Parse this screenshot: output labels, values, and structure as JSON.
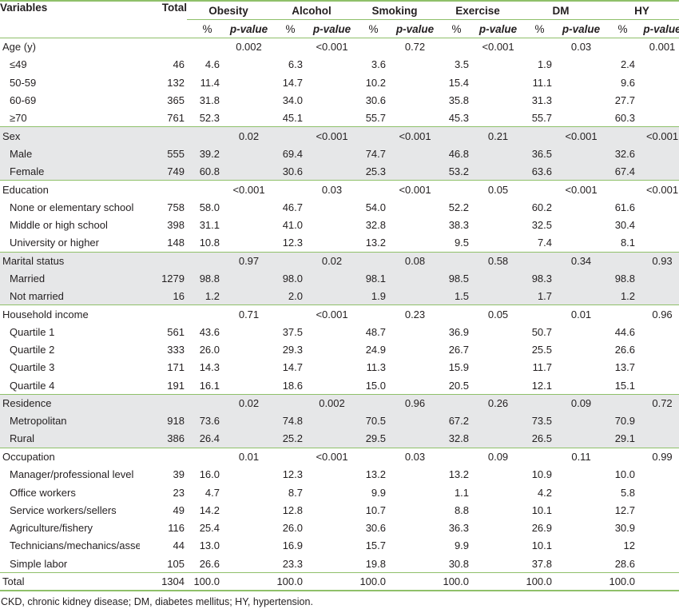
{
  "header": {
    "variables": "Variables",
    "total": "Total",
    "groups": [
      "Obesity",
      "Alcohol",
      "Smoking",
      "Exercise",
      "DM",
      "HY"
    ],
    "pct": "%",
    "pvalue": "p-value"
  },
  "sections": [
    {
      "label": "Age (y)",
      "shade": false,
      "pvalues": [
        "0.002",
        "<0.001",
        "0.72",
        "<0.001",
        "0.03",
        "0.001"
      ],
      "rows": [
        {
          "label": "≤49",
          "total": "46",
          "values": [
            "4.6",
            "6.3",
            "3.6",
            "3.5",
            "1.9",
            "2.4"
          ]
        },
        {
          "label": "50-59",
          "total": "132",
          "values": [
            "11.4",
            "14.7",
            "10.2",
            "15.4",
            "11.1",
            "9.6"
          ]
        },
        {
          "label": "60-69",
          "total": "365",
          "values": [
            "31.8",
            "34.0",
            "30.6",
            "35.8",
            "31.3",
            "27.7"
          ]
        },
        {
          "label": "≥70",
          "total": "761",
          "values": [
            "52.3",
            "45.1",
            "55.7",
            "45.3",
            "55.7",
            "60.3"
          ]
        }
      ]
    },
    {
      "label": "Sex",
      "shade": true,
      "pvalues": [
        "0.02",
        "<0.001",
        "<0.001",
        "0.21",
        "<0.001",
        "<0.001"
      ],
      "rows": [
        {
          "label": "Male",
          "total": "555",
          "values": [
            "39.2",
            "69.4",
            "74.7",
            "46.8",
            "36.5",
            "32.6"
          ]
        },
        {
          "label": "Female",
          "total": "749",
          "values": [
            "60.8",
            "30.6",
            "25.3",
            "53.2",
            "63.6",
            "67.4"
          ]
        }
      ]
    },
    {
      "label": "Education",
      "shade": false,
      "pvalues": [
        "<0.001",
        "0.03",
        "<0.001",
        "0.05",
        "<0.001",
        "<0.001"
      ],
      "rows": [
        {
          "label": "None or elementary school",
          "total": "758",
          "values": [
            "58.0",
            "46.7",
            "54.0",
            "52.2",
            "60.2",
            "61.6"
          ]
        },
        {
          "label": "Middle or high school",
          "total": "398",
          "values": [
            "31.1",
            "41.0",
            "32.8",
            "38.3",
            "32.5",
            "30.4"
          ]
        },
        {
          "label": "University or higher",
          "total": "148",
          "values": [
            "10.8",
            "12.3",
            "13.2",
            "9.5",
            "7.4",
            "8.1"
          ]
        }
      ]
    },
    {
      "label": "Marital status",
      "shade": true,
      "pvalues": [
        "0.97",
        "0.02",
        "0.08",
        "0.58",
        "0.34",
        "0.93"
      ],
      "rows": [
        {
          "label": "Married",
          "total": "1279",
          "values": [
            "98.8",
            "98.0",
            "98.1",
            "98.5",
            "98.3",
            "98.8"
          ]
        },
        {
          "label": "Not married",
          "total": "16",
          "values": [
            "1.2",
            "2.0",
            "1.9",
            "1.5",
            "1.7",
            "1.2"
          ]
        }
      ]
    },
    {
      "label": "Household income",
      "shade": false,
      "pvalues": [
        "0.71",
        "<0.001",
        "0.23",
        "0.05",
        "0.01",
        "0.96"
      ],
      "rows": [
        {
          "label": "Quartile 1",
          "total": "561",
          "values": [
            "43.6",
            "37.5",
            "48.7",
            "36.9",
            "50.7",
            "44.6"
          ]
        },
        {
          "label": "Quartile 2",
          "total": "333",
          "values": [
            "26.0",
            "29.3",
            "24.9",
            "26.7",
            "25.5",
            "26.6"
          ]
        },
        {
          "label": "Quartile 3",
          "total": "171",
          "values": [
            "14.3",
            "14.7",
            "11.3",
            "15.9",
            "11.7",
            "13.7"
          ]
        },
        {
          "label": "Quartile 4",
          "total": "191",
          "values": [
            "16.1",
            "18.6",
            "15.0",
            "20.5",
            "12.1",
            "15.1"
          ]
        }
      ]
    },
    {
      "label": "Residence",
      "shade": true,
      "pvalues": [
        "0.02",
        "0.002",
        "0.96",
        "0.26",
        "0.09",
        "0.72"
      ],
      "rows": [
        {
          "label": "Metropolitan",
          "total": "918",
          "values": [
            "73.6",
            "74.8",
            "70.5",
            "67.2",
            "73.5",
            "70.9"
          ]
        },
        {
          "label": "Rural",
          "total": "386",
          "values": [
            "26.4",
            "25.2",
            "29.5",
            "32.8",
            "26.5",
            "29.1"
          ]
        }
      ]
    },
    {
      "label": "Occupation",
      "shade": false,
      "pvalues": [
        "0.01",
        "<0.001",
        "0.03",
        "0.09",
        "0.11",
        "0.99"
      ],
      "rows": [
        {
          "label": "Manager/professional level",
          "total": "39",
          "values": [
            "16.0",
            "12.3",
            "13.2",
            "13.2",
            "10.9",
            "10.0"
          ]
        },
        {
          "label": "Office workers",
          "total": "23",
          "values": [
            "4.7",
            "8.7",
            "9.9",
            "1.1",
            "4.2",
            "5.8"
          ]
        },
        {
          "label": "Service workers/sellers",
          "total": "49",
          "values": [
            "14.2",
            "12.8",
            "10.7",
            "8.8",
            "10.1",
            "12.7"
          ]
        },
        {
          "label": "Agriculture/fishery",
          "total": "116",
          "values": [
            "25.4",
            "26.0",
            "30.6",
            "36.3",
            "26.9",
            "30.9"
          ]
        },
        {
          "label": "Technicians/mechanics/assemblers",
          "total": "44",
          "values": [
            "13.0",
            "16.9",
            "15.7",
            "9.9",
            "10.1",
            "12"
          ]
        },
        {
          "label": "Simple labor",
          "total": "105",
          "values": [
            "26.6",
            "23.3",
            "19.8",
            "30.8",
            "37.8",
            "28.6"
          ]
        }
      ]
    }
  ],
  "total_row": {
    "label": "Total",
    "total": "1304",
    "values": [
      "100.0",
      "100.0",
      "100.0",
      "100.0",
      "100.0",
      "100.0"
    ]
  },
  "footnote": "CKD, chronic kidney disease; DM, diabetes mellitus; HY, hypertension."
}
